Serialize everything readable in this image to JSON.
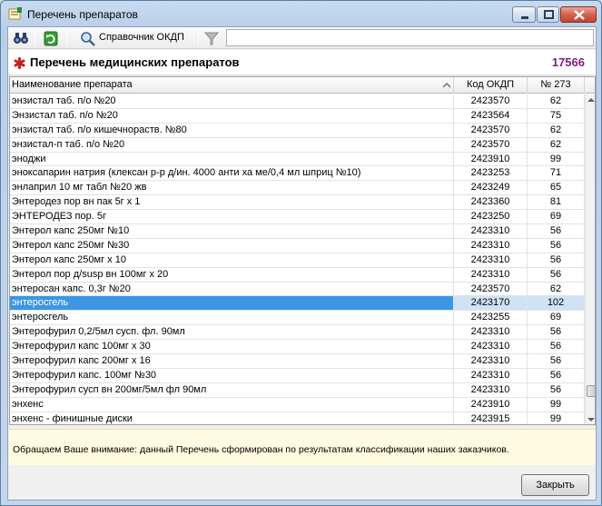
{
  "window": {
    "title": "Перечень препаратов"
  },
  "toolbar": {
    "okdp_label": "Справочник ОКДП",
    "search_value": ""
  },
  "header": {
    "title": "Перечень медицинских препаратов",
    "count": "17566"
  },
  "table": {
    "columns": [
      "Наименование препарата",
      "Код ОКДП",
      "№ 273"
    ],
    "rows": [
      [
        "энзистал таб. п/о №20",
        "2423570",
        "62"
      ],
      [
        "Энзистал таб. п/о №20",
        "2423564",
        "75"
      ],
      [
        "энзистал таб. п/о кишечнораств. №80",
        "2423570",
        "62"
      ],
      [
        "энзистал-п таб. п/о №20",
        "2423570",
        "62"
      ],
      [
        "эноджи",
        "2423910",
        "99"
      ],
      [
        "эноксапарин натрия (клексан р-р д/ин. 4000 анти ха ме/0,4 мл шприц №10)",
        "2423253",
        "71"
      ],
      [
        "энлаприл 10 мг табл №20 жв",
        "2423249",
        "65"
      ],
      [
        "Энтеродез пор вн пак 5г х 1",
        "2423360",
        "81"
      ],
      [
        "ЭНТЕРОДЕЗ пор. 5г",
        "2423250",
        "69"
      ],
      [
        "Энтерол капс 250мг №10",
        "2423310",
        "56"
      ],
      [
        "Энтерол капс 250мг №30",
        "2423310",
        "56"
      ],
      [
        "Энтерол капс 250мг х 10",
        "2423310",
        "56"
      ],
      [
        "Энтерол пор д/susp вн 100мг х 20",
        "2423310",
        "56"
      ],
      [
        "энтеросан капс. 0,3г №20",
        "2423570",
        "62"
      ],
      [
        "энтеросгель",
        "2423170",
        "102"
      ],
      [
        "энтеросгель",
        "2423255",
        "69"
      ],
      [
        "Энтерофурил 0,2/5мл сусп. фл. 90мл",
        "2423310",
        "56"
      ],
      [
        "Энтерофурил капс 100мг х 30",
        "2423310",
        "56"
      ],
      [
        "Энтерофурил капс 200мг х 16",
        "2423310",
        "56"
      ],
      [
        "Энтерофурил капс. 100мг №30",
        "2423310",
        "56"
      ],
      [
        "Энтерофурил сусп вн 200мг/5мл фл 90мл",
        "2423310",
        "56"
      ],
      [
        "энхенс",
        "2423910",
        "99"
      ],
      [
        "энхенс - финишные диски",
        "2423915",
        "99"
      ]
    ],
    "selected_row": 14
  },
  "notice": {
    "text": "Обращаем Ваше внимание: данный Перечень сформирован по результатам классификации наших заказчиков."
  },
  "footer": {
    "close_label": "Закрыть"
  },
  "colors": {
    "selection": "#3d96e3",
    "count": "#7a1f7a",
    "notice_bg": "#fffbe0"
  },
  "icons": [
    "binoculars-icon",
    "refresh-icon",
    "magnifier-icon",
    "filter-icon",
    "asterisk-icon"
  ]
}
